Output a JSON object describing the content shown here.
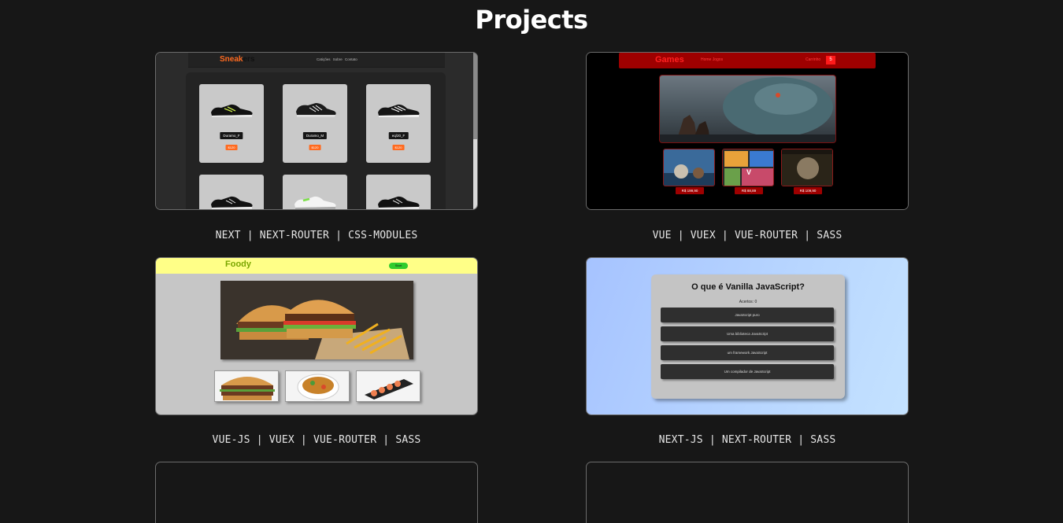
{
  "page": {
    "title": "Projects"
  },
  "projects": [
    {
      "tags": "NEXT | NEXT-ROUTER | CSS-MODULES",
      "preview": {
        "logo_main": "Sneak",
        "logo_rest": "ers",
        "nav_links": "Catições Sobre Contato",
        "products": [
          {
            "name": "Duramo_F",
            "price": "$120"
          },
          {
            "name": "Duramo_M",
            "price": "$120"
          },
          {
            "name": "eq/20_F",
            "price": "$120"
          }
        ],
        "accent": "#ff6a1f"
      }
    },
    {
      "tags": "VUE | VUEX | VUE-ROUTER | SASS",
      "preview": {
        "logo": "Games",
        "nav_links": "Home Jogos",
        "cart_label": "Carrinho",
        "cart_count": "5",
        "prices": [
          "R$ 199,90",
          "R$ 88,89",
          "R$ 109,90"
        ],
        "accent": "#9e0000"
      }
    },
    {
      "tags": "VUE-JS | VUEX | VUE-ROUTER | SASS",
      "preview": {
        "logo": "Foody",
        "nav_button": "Start",
        "accent": "#ffff87"
      }
    },
    {
      "tags": "NEXT-JS | NEXT-ROUTER | SASS",
      "preview": {
        "question": "O que é Vanilla JavaScript?",
        "score": "Acertos: 0",
        "options": [
          "JavaScript puro",
          "Uma biblioteca JavaScript",
          "um framework JavaScript",
          "Um compilador de JavaScript"
        ]
      }
    }
  ]
}
